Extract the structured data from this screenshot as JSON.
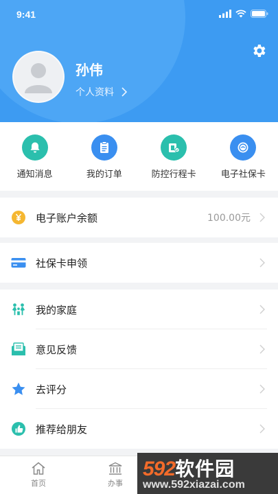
{
  "status_bar": {
    "time": "9:41"
  },
  "profile": {
    "name": "孙伟",
    "profile_link": "个人资料"
  },
  "shortcuts": [
    {
      "label": "通知消息",
      "icon": "bell-icon",
      "color": "#2bbfad"
    },
    {
      "label": "我的订单",
      "icon": "order-list-icon",
      "color": "#3a8ff0"
    },
    {
      "label": "防控行程卡",
      "icon": "travel-card-icon",
      "color": "#2bbfad"
    },
    {
      "label": "电子社保卡",
      "icon": "social-security-card-icon",
      "color": "#3a8ff0"
    }
  ],
  "menu": {
    "balance": {
      "label": "电子账户余额",
      "value": "100.00元",
      "icon": "yuan-coin-icon",
      "color": "#f5b731"
    },
    "social_card_apply": {
      "label": "社保卡申领",
      "icon": "card-icon",
      "color": "#3a8ff0"
    },
    "family": {
      "label": "我的家庭",
      "icon": "family-icon",
      "color": "#2bbfad"
    },
    "feedback": {
      "label": "意见反馈",
      "icon": "feedback-icon",
      "color": "#2bbfad"
    },
    "rate": {
      "label": "去评分",
      "icon": "star-icon",
      "color": "#3a8ff0"
    },
    "recommend": {
      "label": "推荐给朋友",
      "icon": "thumbs-up-icon",
      "color": "#2bbfad"
    }
  },
  "tabbar": [
    {
      "label": "首页",
      "icon": "home-icon"
    },
    {
      "label": "办事",
      "icon": "government-building-icon"
    }
  ],
  "watermark": {
    "number": "592",
    "brand": "软件园",
    "url": "www.592xiazai.com"
  },
  "colors": {
    "header_blue": "#3d9bf2",
    "teal": "#2bbfad",
    "blue": "#3a8ff0"
  }
}
